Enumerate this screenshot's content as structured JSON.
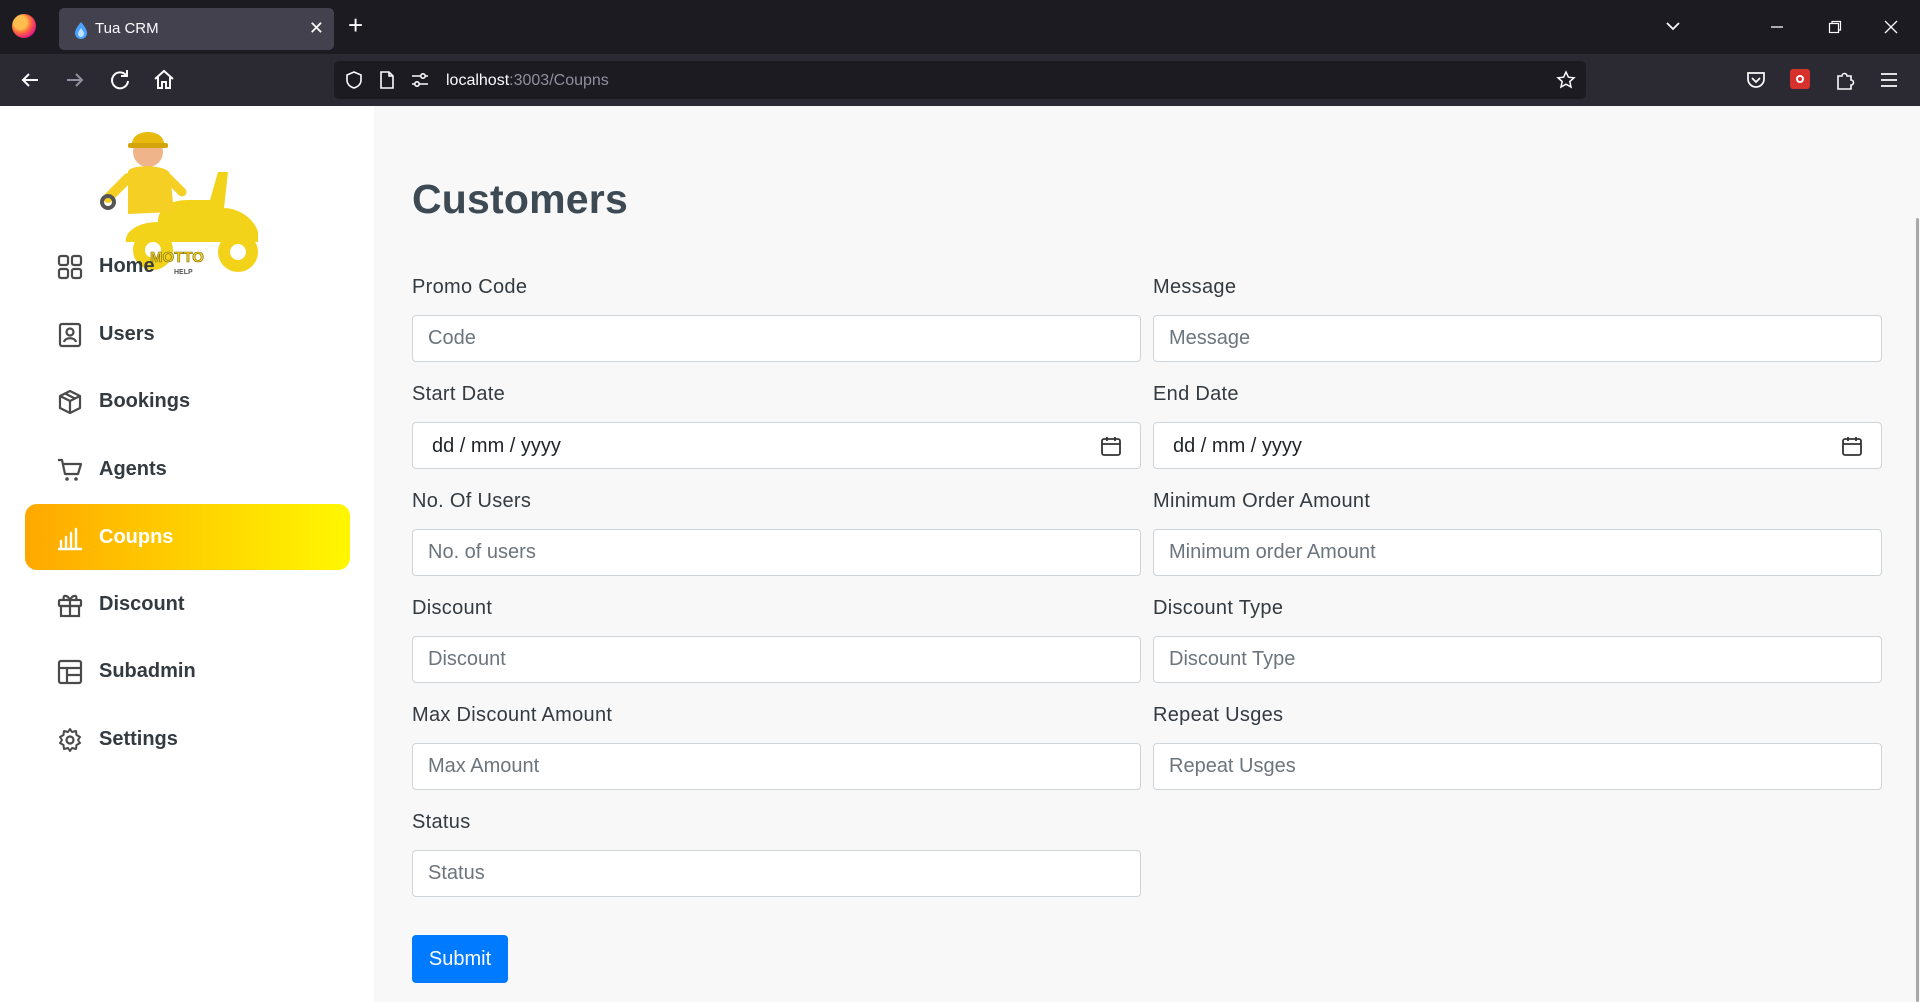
{
  "browser": {
    "tab_title": "Tua CRM",
    "url_host": "localhost",
    "url_path": ":3003/Coupns"
  },
  "sidebar": {
    "logo_text": "MOTTO HELP",
    "items": [
      {
        "label": "Home",
        "icon": "grid-icon",
        "active": false
      },
      {
        "label": "Users",
        "icon": "user-badge-icon",
        "active": false
      },
      {
        "label": "Bookings",
        "icon": "package-icon",
        "active": false
      },
      {
        "label": "Agents",
        "icon": "cart-icon",
        "active": false
      },
      {
        "label": "Coupns",
        "icon": "bar-chart-icon",
        "active": true
      },
      {
        "label": "Discount",
        "icon": "gift-icon",
        "active": false
      },
      {
        "label": "Subadmin",
        "icon": "layout-icon",
        "active": false
      },
      {
        "label": "Settings",
        "icon": "gear-icon",
        "active": false
      }
    ],
    "active_color_start": "#ffa800",
    "active_color_end": "#fff700"
  },
  "main": {
    "title": "Customers",
    "fields": {
      "promo_code": {
        "label": "Promo Code",
        "placeholder": "Code"
      },
      "message": {
        "label": "Message",
        "placeholder": "Message"
      },
      "start_date": {
        "label": "Start Date",
        "placeholder": "dd / mm / yyyy"
      },
      "end_date": {
        "label": "End Date",
        "placeholder": "dd / mm / yyyy"
      },
      "no_of_users": {
        "label": "No. Of Users",
        "placeholder": "No. of users"
      },
      "min_order": {
        "label": "Minimum Order Amount",
        "placeholder": "Minimum order Amount"
      },
      "discount": {
        "label": "Discount",
        "placeholder": "Discount"
      },
      "discount_type": {
        "label": "Discount Type",
        "placeholder": "Discount Type"
      },
      "max_discount": {
        "label": "Max Discount Amount",
        "placeholder": "Max Amount"
      },
      "repeat_usges": {
        "label": "Repeat Usges",
        "placeholder": "Repeat Usges"
      },
      "status": {
        "label": "Status",
        "placeholder": "Status"
      }
    },
    "submit_label": "Submit",
    "submit_color": "#007bff"
  }
}
